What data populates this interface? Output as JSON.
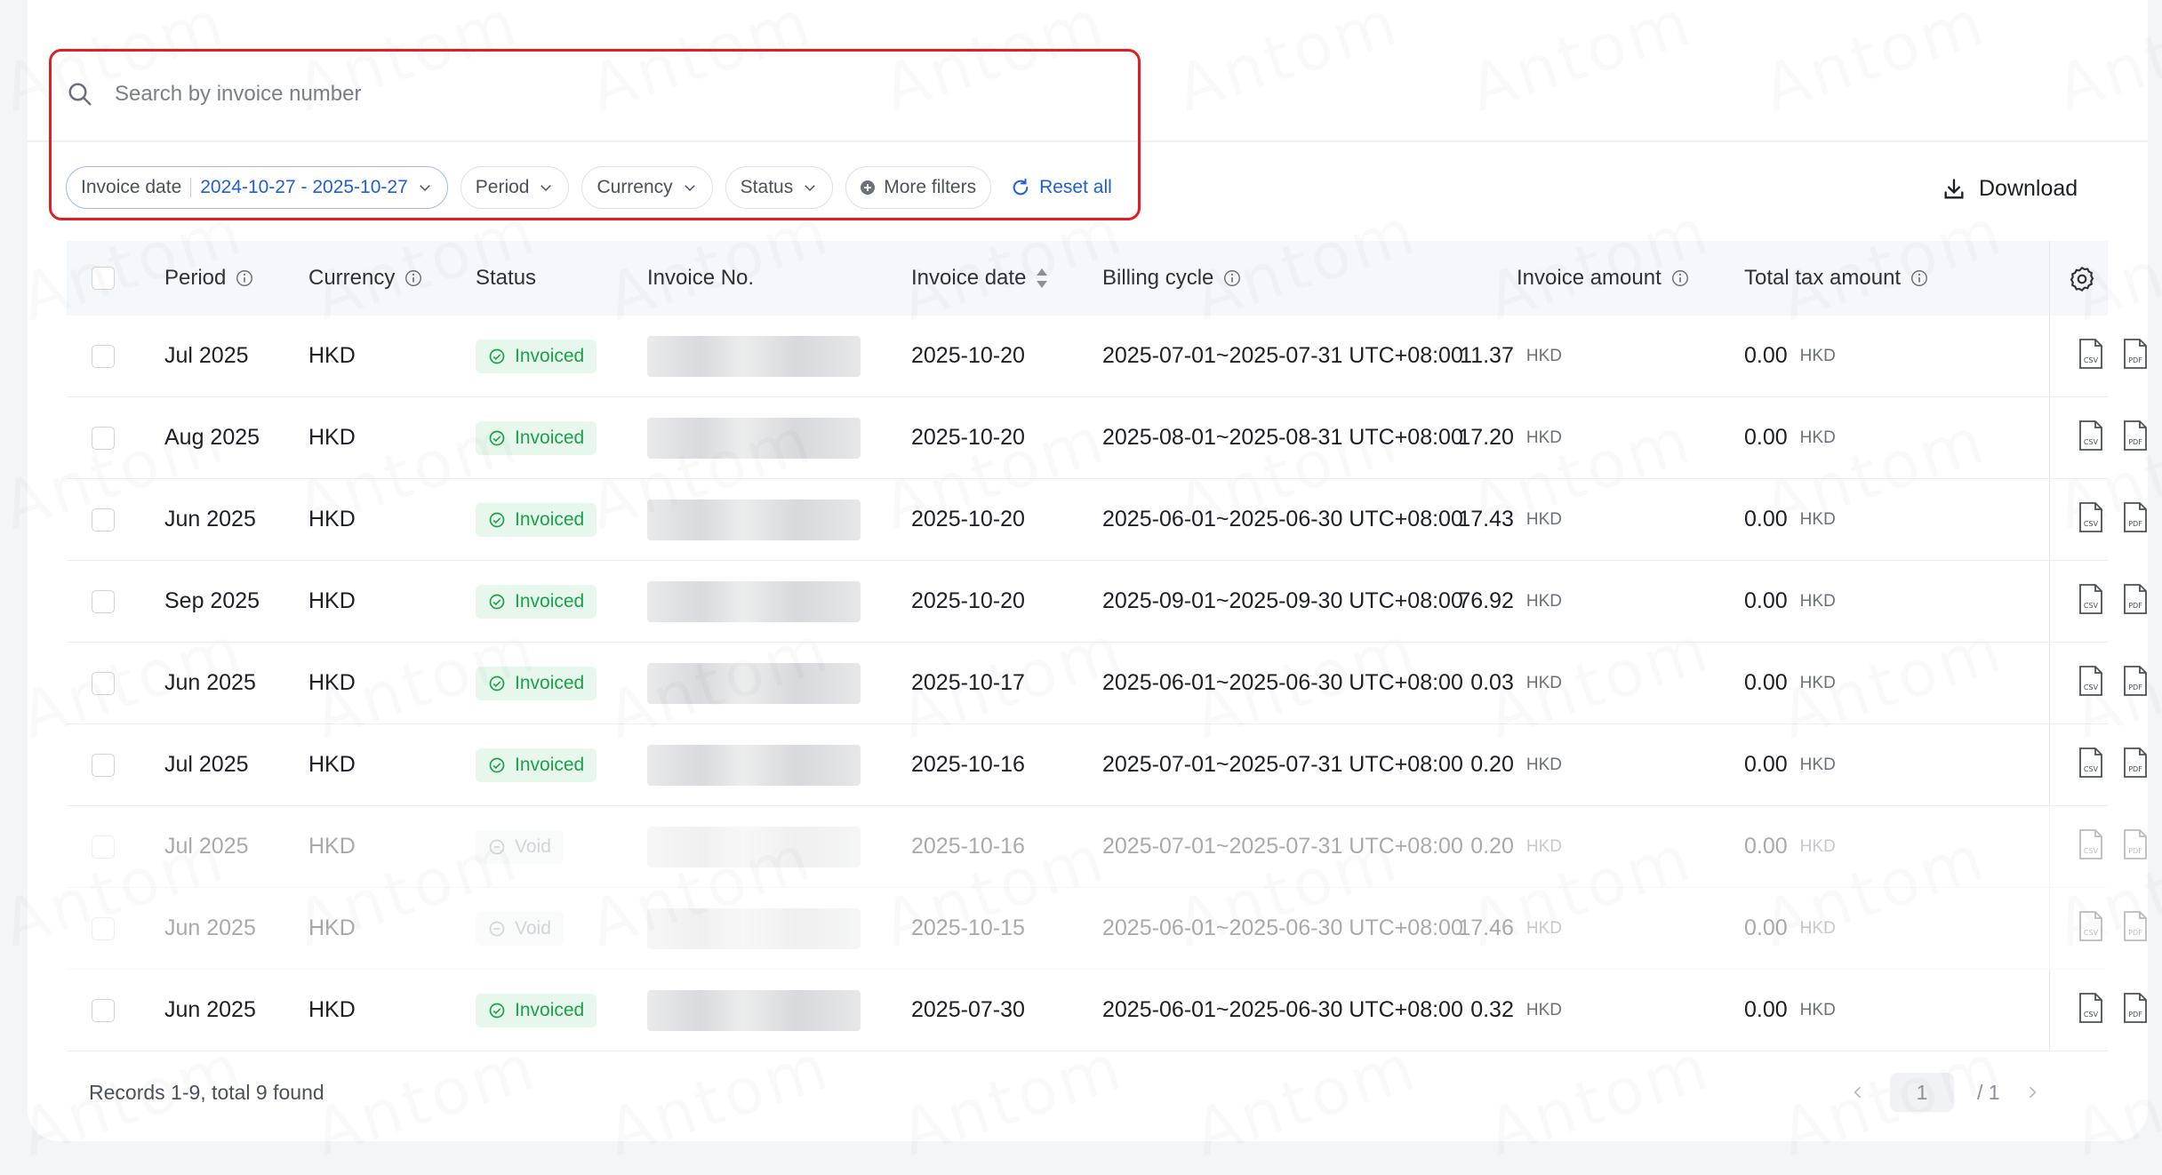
{
  "search": {
    "placeholder": "Search by invoice number"
  },
  "filters": {
    "invoice_date_label": "Invoice date",
    "invoice_date_value": "2024-10-27 - 2025-10-27",
    "period": "Period",
    "currency": "Currency",
    "status": "Status",
    "more": "More filters",
    "reset": "Reset all"
  },
  "toolbar": {
    "download": "Download"
  },
  "columns": {
    "period": "Period",
    "currency": "Currency",
    "status": "Status",
    "invoice_no": "Invoice No.",
    "invoice_date": "Invoice date",
    "billing_cycle": "Billing cycle",
    "invoice_amount": "Invoice amount",
    "total_tax": "Total tax amount"
  },
  "rows": [
    {
      "period": "Jul 2025",
      "currency": "HKD",
      "status": "Invoiced",
      "void": false,
      "date": "2025-10-20",
      "cycle": "2025-07-01~2025-07-31 UTC+08:00",
      "amount": "11.37",
      "amount_cur": "HKD",
      "tax": "0.00",
      "tax_cur": "HKD"
    },
    {
      "period": "Aug 2025",
      "currency": "HKD",
      "status": "Invoiced",
      "void": false,
      "date": "2025-10-20",
      "cycle": "2025-08-01~2025-08-31 UTC+08:00",
      "amount": "17.20",
      "amount_cur": "HKD",
      "tax": "0.00",
      "tax_cur": "HKD"
    },
    {
      "period": "Jun 2025",
      "currency": "HKD",
      "status": "Invoiced",
      "void": false,
      "date": "2025-10-20",
      "cycle": "2025-06-01~2025-06-30 UTC+08:00",
      "amount": "17.43",
      "amount_cur": "HKD",
      "tax": "0.00",
      "tax_cur": "HKD"
    },
    {
      "period": "Sep 2025",
      "currency": "HKD",
      "status": "Invoiced",
      "void": false,
      "date": "2025-10-20",
      "cycle": "2025-09-01~2025-09-30 UTC+08:00",
      "amount": "76.92",
      "amount_cur": "HKD",
      "tax": "0.00",
      "tax_cur": "HKD"
    },
    {
      "period": "Jun 2025",
      "currency": "HKD",
      "status": "Invoiced",
      "void": false,
      "date": "2025-10-17",
      "cycle": "2025-06-01~2025-06-30 UTC+08:00",
      "amount": "0.03",
      "amount_cur": "HKD",
      "tax": "0.00",
      "tax_cur": "HKD"
    },
    {
      "period": "Jul 2025",
      "currency": "HKD",
      "status": "Invoiced",
      "void": false,
      "date": "2025-10-16",
      "cycle": "2025-07-01~2025-07-31 UTC+08:00",
      "amount": "0.20",
      "amount_cur": "HKD",
      "tax": "0.00",
      "tax_cur": "HKD"
    },
    {
      "period": "Jul 2025",
      "currency": "HKD",
      "status": "Void",
      "void": true,
      "date": "2025-10-16",
      "cycle": "2025-07-01~2025-07-31 UTC+08:00",
      "amount": "0.20",
      "amount_cur": "HKD",
      "tax": "0.00",
      "tax_cur": "HKD"
    },
    {
      "period": "Jun 2025",
      "currency": "HKD",
      "status": "Void",
      "void": true,
      "date": "2025-10-15",
      "cycle": "2025-06-01~2025-06-30 UTC+08:00",
      "amount": "17.46",
      "amount_cur": "HKD",
      "tax": "0.00",
      "tax_cur": "HKD"
    },
    {
      "period": "Jun 2025",
      "currency": "HKD",
      "status": "Invoiced",
      "void": false,
      "date": "2025-07-30",
      "cycle": "2025-06-01~2025-06-30 UTC+08:00",
      "amount": "0.32",
      "amount_cur": "HKD",
      "tax": "0.00",
      "tax_cur": "HKD"
    }
  ],
  "footer": {
    "records": "Records 1-9, total 9 found"
  },
  "pagination": {
    "current": "1",
    "total": "/ 1"
  },
  "watermark": "Antom",
  "colors": {
    "accent": "#1c5fd6",
    "invoiced": "#18a24a",
    "highlight": "#e02020"
  }
}
